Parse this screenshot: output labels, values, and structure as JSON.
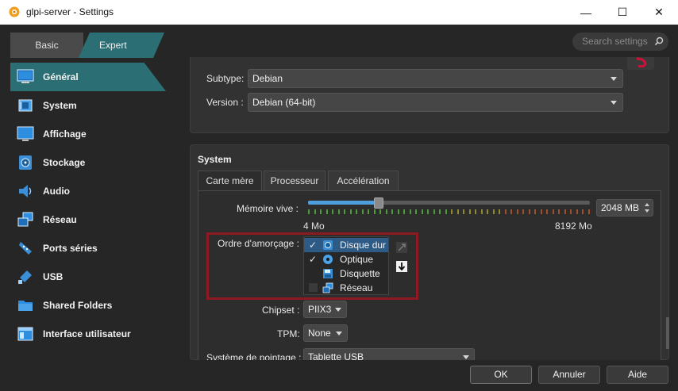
{
  "window": {
    "title": "glpi-server - Settings",
    "minimize": "—",
    "maximize": "☐",
    "close": "✕"
  },
  "mode_tabs": {
    "basic": "Basic",
    "expert": "Expert"
  },
  "search": {
    "placeholder": "Search settings"
  },
  "sidebar": {
    "items": [
      {
        "label": "Général",
        "icon": "general-monitor-icon",
        "active": true
      },
      {
        "label": "System",
        "icon": "system-chip-icon",
        "active": false
      },
      {
        "label": "Affichage",
        "icon": "display-monitor-icon",
        "active": false
      },
      {
        "label": "Stockage",
        "icon": "storage-disk-icon",
        "active": false
      },
      {
        "label": "Audio",
        "icon": "audio-speaker-icon",
        "active": false
      },
      {
        "label": "Réseau",
        "icon": "network-icon",
        "active": false
      },
      {
        "label": "Ports séries",
        "icon": "serial-port-icon",
        "active": false
      },
      {
        "label": "USB",
        "icon": "usb-icon",
        "active": false
      },
      {
        "label": "Shared Folders",
        "icon": "folder-icon",
        "active": false
      },
      {
        "label": "Interface utilisateur",
        "icon": "user-interface-icon",
        "active": false
      }
    ]
  },
  "general": {
    "subtype_label": "Subtype:",
    "subtype_value": "Debian",
    "version_label": "Version :",
    "version_value": "Debian (64-bit)"
  },
  "system": {
    "title": "System",
    "tabs": [
      "Carte mère",
      "Processeur",
      "Accélération"
    ],
    "active_tab": 0,
    "memory": {
      "label": "Mémoire vive :",
      "value_text": "2048 MB",
      "min_label": "4 Mo",
      "max_label": "8192 Mo",
      "fraction": 0.25
    },
    "boot_order": {
      "label": "Ordre d'amorçage :",
      "items": [
        {
          "label": "Disque dur",
          "checked": true,
          "selected": true,
          "icon": "hard-disk-icon"
        },
        {
          "label": "Optique",
          "checked": true,
          "selected": false,
          "icon": "optical-disc-icon"
        },
        {
          "label": "Disquette",
          "checked": false,
          "selected": false,
          "icon": "floppy-icon"
        },
        {
          "label": "Réseau",
          "checked": false,
          "selected": false,
          "icon": "network-icon"
        }
      ],
      "check_mark": "✓"
    },
    "chipset": {
      "label": "Chipset :",
      "value": "PIIX3"
    },
    "tpm": {
      "label": "TPM:",
      "value": "None"
    },
    "pointing": {
      "label": "Système de pointage :",
      "value": "Tablette USB"
    }
  },
  "buttons": {
    "ok": "OK",
    "cancel": "Annuler",
    "help": "Aide"
  },
  "colors": {
    "accent": "#2b6f74",
    "highlight_border": "#8d1a22",
    "selection": "#2e5a86"
  }
}
